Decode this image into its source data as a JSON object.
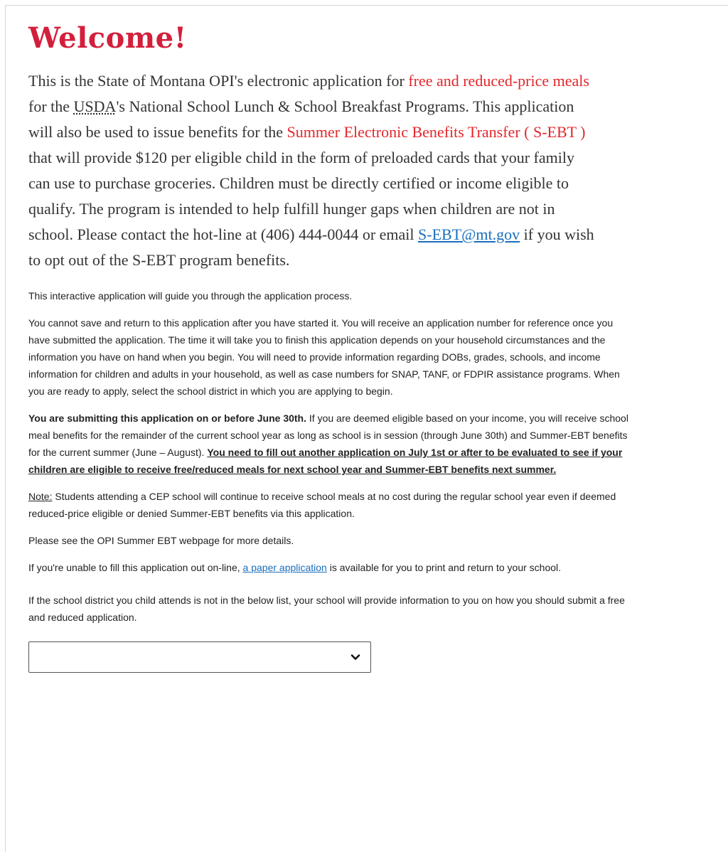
{
  "title": "Welcome!",
  "intro": {
    "p1": "This is the State of Montana OPI's electronic application for ",
    "link_free": "free and reduced-price meals",
    "p2": " for the ",
    "usda": "USDA",
    "p3": "'s National School Lunch & School Breakfast Programs. This application will also be used to issue benefits for the ",
    "link_sebt": "Summer Electronic Benefits Transfer ( S-EBT )",
    "p4": " that will provide $120 per eligible child in the form of preloaded cards that your family can use to purchase groceries. Children must be directly certified or income eligible to qualify. The program is intended to help fulfill hunger gaps when children are not in school. Please contact the hot-line at (406) 444-0044 or email ",
    "email": "S-EBT@mt.gov",
    "p5": " if you wish to opt out of the S-EBT program benefits."
  },
  "paragraphs": {
    "guide": "This interactive application will guide you through the application process.",
    "cannot_save": "You cannot save and return to this application after you have started it. You will receive an application number for reference once you have submitted the application. The time it will take you to finish this application depends on your household circumstances and the information you have on hand when you begin. You will need to provide information regarding DOBs, grades, schools, and income information for children and adults in your household, as well as case numbers for SNAP, TANF, or FDPIR assistance programs. When you are ready to apply, select the school district in which you are applying to begin.",
    "june_bold": "You are submitting this application on or before June 30th.",
    "june_text": " If you are deemed eligible based on your income, you will receive school meal benefits for the remainder of the current school year as long as school is in session (through June 30th) and Summer-EBT benefits for the current summer (June – August). ",
    "june_underline": "You need to fill out another application on July 1st or after to be evaluated to see if your children are eligible to receive free/reduced meals for next school year and Summer-EBT benefits next summer.",
    "note_label": "Note:",
    "note_text": " Students attending a CEP school will continue to receive school meals at no cost during the regular school year even if deemed reduced-price eligible or denied Summer-EBT benefits via this application.",
    "see_opi": "Please see the OPI Summer EBT webpage for more details.",
    "paper_pre": "If you're unable to fill this application out on-line, ",
    "paper_link": "a paper application",
    "paper_post": " is available for you to print and return to your school.",
    "district": "If the school district you child attends is not in the below list, your school will provide information to you on how you should submit a free and reduced application."
  },
  "district_select": {
    "selected": "",
    "icon": "chevron-down-icon"
  },
  "colors": {
    "title": "#d31f3b",
    "highlight": "#e3262b",
    "link": "#1a6fbd"
  }
}
